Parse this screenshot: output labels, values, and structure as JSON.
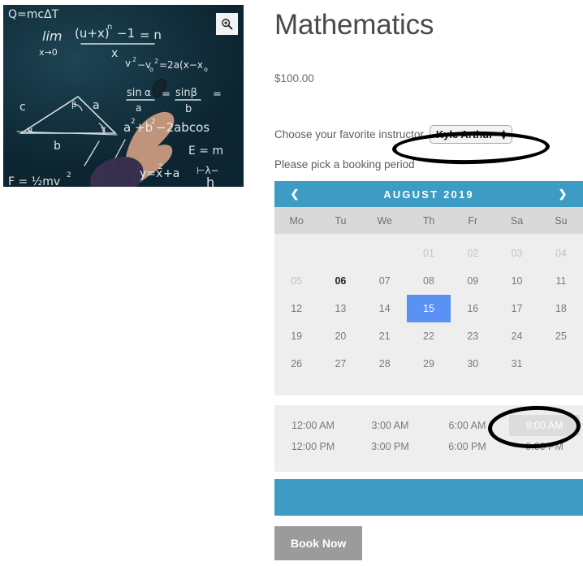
{
  "product": {
    "title": "Mathematics",
    "price": "$100.00",
    "image_alt": "chalkboard-with-math-formulas",
    "zoom_icon": "magnify-plus-icon"
  },
  "instructor": {
    "label": "Choose your favorite instructor",
    "selected": "Kyle Arthur",
    "options": [
      "Kyle Arthur"
    ]
  },
  "booking": {
    "period_label": "Please pick a booking period",
    "book_button": "Book Now"
  },
  "calendar": {
    "month_title": "AUGUST 2019",
    "prev_icon": "chevron-left-icon",
    "next_icon": "chevron-right-icon",
    "weekdays": [
      "Mo",
      "Tu",
      "We",
      "Th",
      "Fr",
      "Sa",
      "Su"
    ],
    "today": "06",
    "selected_day": "15",
    "days": [
      {
        "label": "",
        "state": "empty"
      },
      {
        "label": "",
        "state": "empty"
      },
      {
        "label": "",
        "state": "empty"
      },
      {
        "label": "01",
        "state": "muted"
      },
      {
        "label": "02",
        "state": "muted"
      },
      {
        "label": "03",
        "state": "muted"
      },
      {
        "label": "04",
        "state": "muted"
      },
      {
        "label": "05",
        "state": "muted"
      },
      {
        "label": "06",
        "state": "today"
      },
      {
        "label": "07",
        "state": "normal"
      },
      {
        "label": "08",
        "state": "normal"
      },
      {
        "label": "09",
        "state": "normal"
      },
      {
        "label": "10",
        "state": "normal"
      },
      {
        "label": "11",
        "state": "normal"
      },
      {
        "label": "12",
        "state": "normal"
      },
      {
        "label": "13",
        "state": "normal"
      },
      {
        "label": "14",
        "state": "normal"
      },
      {
        "label": "15",
        "state": "selected"
      },
      {
        "label": "16",
        "state": "normal"
      },
      {
        "label": "17",
        "state": "normal"
      },
      {
        "label": "18",
        "state": "normal"
      },
      {
        "label": "19",
        "state": "normal"
      },
      {
        "label": "20",
        "state": "normal"
      },
      {
        "label": "21",
        "state": "normal"
      },
      {
        "label": "22",
        "state": "normal"
      },
      {
        "label": "23",
        "state": "normal"
      },
      {
        "label": "24",
        "state": "normal"
      },
      {
        "label": "25",
        "state": "normal"
      },
      {
        "label": "26",
        "state": "normal"
      },
      {
        "label": "27",
        "state": "normal"
      },
      {
        "label": "28",
        "state": "normal"
      },
      {
        "label": "29",
        "state": "normal"
      },
      {
        "label": "30",
        "state": "normal"
      },
      {
        "label": "31",
        "state": "normal"
      },
      {
        "label": "",
        "state": "empty"
      }
    ]
  },
  "timeslots": {
    "active": "9:00 AM",
    "slots": [
      {
        "label": "12:00 AM",
        "state": "normal"
      },
      {
        "label": "3:00 AM",
        "state": "normal"
      },
      {
        "label": "6:00 AM",
        "state": "normal"
      },
      {
        "label": "9:00 AM",
        "state": "active"
      },
      {
        "label": "12:00 PM",
        "state": "normal"
      },
      {
        "label": "3:00 PM",
        "state": "normal"
      },
      {
        "label": "6:00 PM",
        "state": "normal"
      },
      {
        "label": "9:00 PM",
        "state": "normal"
      }
    ]
  },
  "summary": {
    "text": ""
  },
  "colors": {
    "accent_blue": "#3d9bc4",
    "selected_day_blue": "#5a91f5",
    "panel_gray": "#eeeeee",
    "weekday_gray": "#d9d9d9",
    "button_gray": "#9b9b9b",
    "annotation": "#000000"
  },
  "chalk_formulas": [
    "Q=mcΔT",
    "lim (u+x)ⁿ -1 / x = n",
    "x→0",
    "v²-vₒ² = 2a(x-xₒ)",
    "sinα/a = sinβ/b =",
    "a²+b²-2abcos",
    "E = m",
    "y = x²+a",
    "c  a  b  α β γ"
  ]
}
